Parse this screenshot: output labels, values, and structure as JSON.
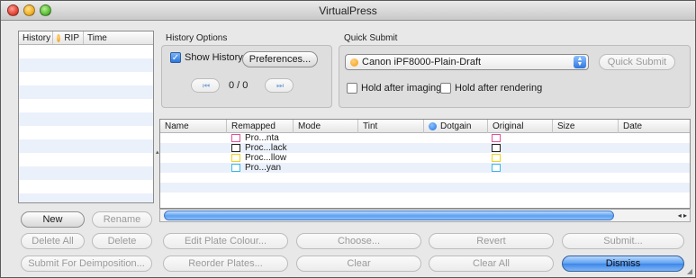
{
  "window": {
    "title": "VirtualPress"
  },
  "history": {
    "columns": {
      "history": "History",
      "rip": "RIP",
      "time": "Time"
    },
    "new_label": "New",
    "rename_label": "Rename"
  },
  "history_options": {
    "label": "History Options",
    "show_history_label": "Show History",
    "show_history_checked": true,
    "preferences_label": "Preferences...",
    "counter": "0 / 0"
  },
  "quick_submit": {
    "label": "Quick Submit",
    "device": "Canon iPF8000-Plain-Draft",
    "button_label": "Quick Submit",
    "hold_after_imaging": "Hold after imaging",
    "hold_after_rendering": "Hold after rendering"
  },
  "plates_table": {
    "columns": [
      "Name",
      "Remapped",
      "Mode",
      "Tint",
      "Dotgain",
      "Original",
      "Size",
      "Date"
    ],
    "rows": [
      {
        "remapped": "Pro...nta",
        "color": "#e0509a"
      },
      {
        "remapped": "Proc...lack",
        "color": "#222222"
      },
      {
        "remapped": "Proc...llow",
        "color": "#f2d21a"
      },
      {
        "remapped": "Pro...yan",
        "color": "#3ab7e8"
      }
    ]
  },
  "buttons": {
    "delete_all": "Delete All",
    "delete": "Delete",
    "submit_deimposition": "Submit For Deimposition...",
    "edit_plate_colour": "Edit Plate Colour...",
    "choose": "Choose...",
    "revert": "Revert",
    "submit": "Submit...",
    "reorder_plates": "Reorder Plates...",
    "clear": "Clear",
    "clear_all": "Clear All",
    "dismiss": "Dismiss"
  },
  "icons": {
    "first": "skip-back-icon",
    "last": "skip-forward-icon",
    "status_dot": "orange-status-icon",
    "dotgain_dot": "blue-status-icon"
  }
}
